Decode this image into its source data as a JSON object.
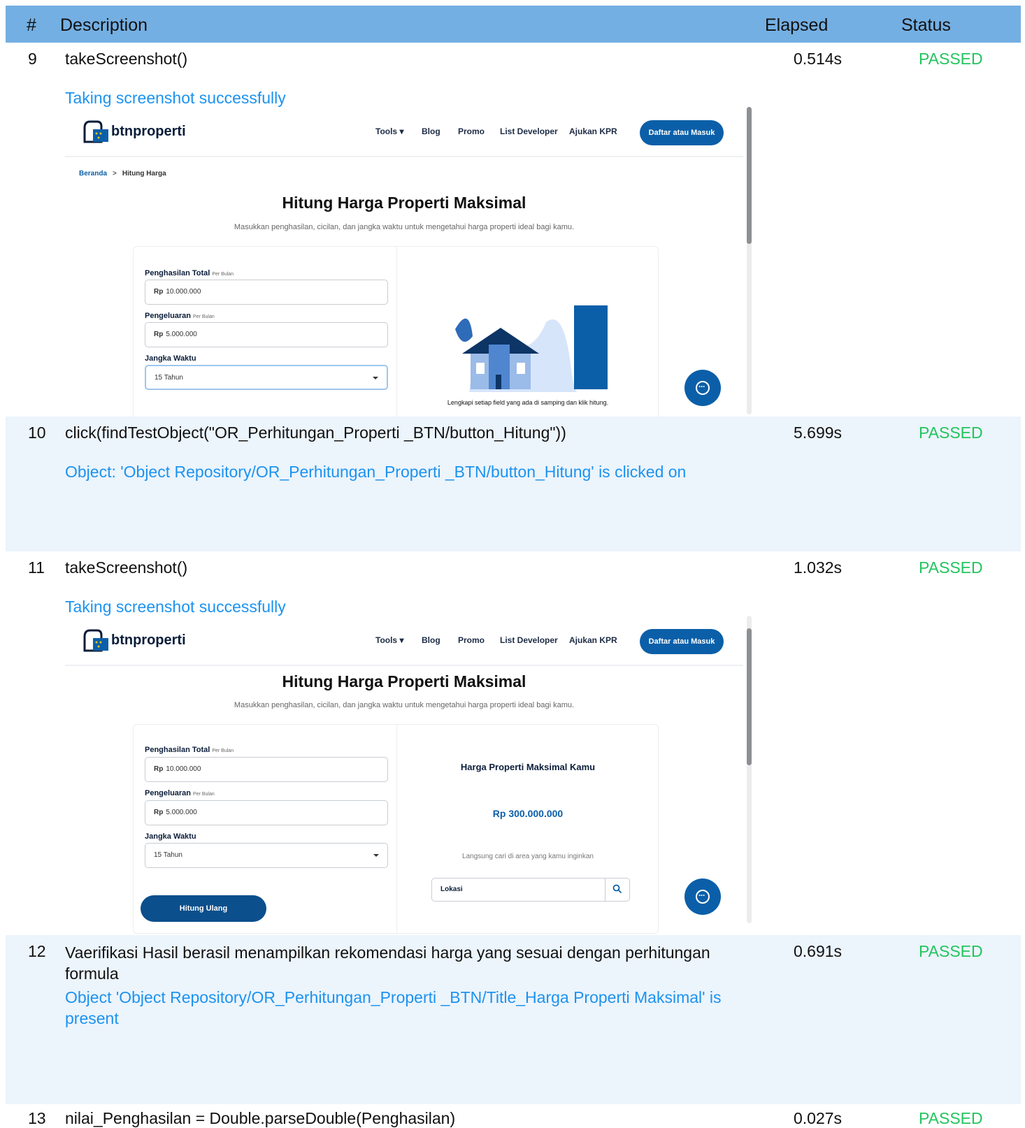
{
  "header": {
    "num": "#",
    "description": "Description",
    "elapsed": "Elapsed",
    "status": "Status"
  },
  "steps": [
    {
      "num": "9",
      "desc": "takeScreenshot()",
      "elapsed": "0.514s",
      "status": "PASSED",
      "message": "Taking screenshot successfully"
    },
    {
      "num": "10",
      "desc": "click(findTestObject(\"OR_Perhitungan_Properti _BTN/button_Hitung\"))",
      "elapsed": "5.699s",
      "status": "PASSED",
      "message": "Object: 'Object Repository/OR_Perhitungan_Properti _BTN/button_Hitung' is clicked on"
    },
    {
      "num": "11",
      "desc": "takeScreenshot()",
      "elapsed": "1.032s",
      "status": "PASSED",
      "message": "Taking screenshot successfully"
    },
    {
      "num": "12",
      "desc_l1": "Vaerifikasi Hasil berasil menampilkan rekomendasi harga yang sesuai dengan perhitungan",
      "desc_l2": "formula",
      "elapsed": "0.691s",
      "status": "PASSED",
      "message_l1": "Object 'Object Repository/OR_Perhitungan_Properti _BTN/Title_Harga Properti Maksimal' is",
      "message_l2": "present"
    },
    {
      "num": "13",
      "desc": "nilai_Penghasilan = Double.parseDouble(Penghasilan)",
      "elapsed": "0.027s",
      "status": "PASSED"
    }
  ],
  "site": {
    "logo": "btnproperti",
    "nav": [
      "Tools",
      "Blog",
      "Promo",
      "List Developer",
      "Ajukan KPR"
    ],
    "cta": "Daftar atau Masuk",
    "breadcrumb_home": "Beranda",
    "breadcrumb_current": "Hitung Harga",
    "title": "Hitung Harga Properti Maksimal",
    "subtitle": "Masukkan penghasilan, cicilan, dan jangka waktu untuk mengetahui harga properti ideal bagi kamu.",
    "label_income": "Penghasilan Total",
    "label_expense": "Pengeluaran",
    "per_month": "Per Bulan",
    "label_term": "Jangka Waktu",
    "currency": "Rp",
    "income_value": "10.000.000",
    "expense_value": "5.000.000",
    "term_value": "15 Tahun",
    "illustration_caption": "Lengkapi setiap field yang ada di samping dan klik hitung.",
    "result_title": "Harga Properti Maksimal Kamu",
    "result_price": "Rp 300.000.000",
    "result_sub": "Langsung cari di area yang kamu inginkan",
    "location_placeholder": "Lokasi",
    "recalc_button": "Hitung Ulang"
  },
  "colors": {
    "header": "#74afe3",
    "passed": "#22c55e",
    "message": "#1c93f0",
    "brand": "#0b5fa8"
  }
}
